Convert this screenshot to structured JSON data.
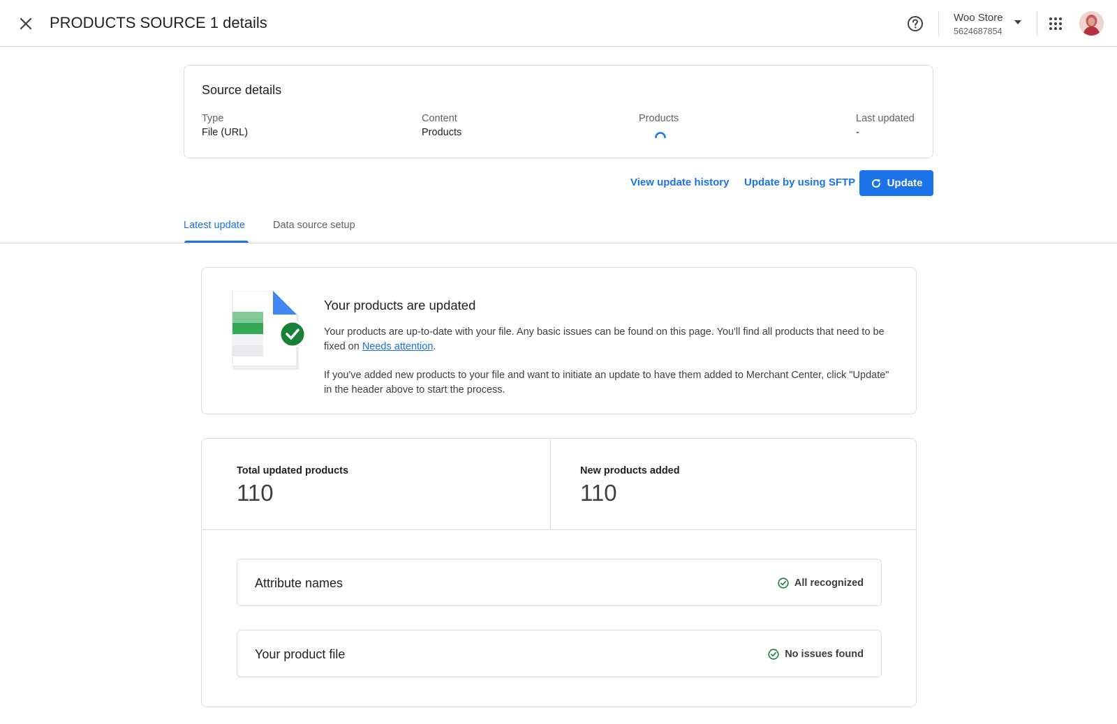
{
  "header": {
    "title": "PRODUCTS SOURCE 1 details",
    "close_icon": "close-icon",
    "help_icon": "help-circle-icon",
    "account_name": "Woo Store",
    "account_id": "5624687854",
    "apps_icon": "apps-grid-icon"
  },
  "source_details": {
    "title": "Source details",
    "fields": [
      {
        "label": "Type",
        "value": "File (URL)"
      },
      {
        "label": "Content",
        "value": "Products"
      },
      {
        "label": "Products",
        "value": ""
      },
      {
        "label": "Last updated",
        "value": "-"
      }
    ]
  },
  "actions": {
    "view_history": "View update history",
    "update_sftp": "Update by using SFTP",
    "update": "Update"
  },
  "tabs": [
    {
      "label": "Latest update",
      "active": true
    },
    {
      "label": "Data source setup",
      "active": false
    }
  ],
  "status": {
    "heading": "Your products are updated",
    "para1_before": "Your products are up-to-date with your file. Any basic issues can be found on this page. You'll find all products that need to be fixed on ",
    "para1_link": "Needs attention",
    "para1_after": ".",
    "para2": "If you've added new products to your file and want to initiate an update to have them added to Merchant Center, click \"Update\" in the header above to start the process."
  },
  "summary": {
    "total_label": "Total updated products",
    "total_value": "110",
    "new_label": "New products added",
    "new_value": "110",
    "checks": [
      {
        "label": "Attribute names",
        "status": "All recognized"
      },
      {
        "label": "Your product file",
        "status": "No issues found"
      }
    ]
  },
  "colors": {
    "accent": "#1a73e8",
    "success": "#188038",
    "border": "#dadce0"
  }
}
